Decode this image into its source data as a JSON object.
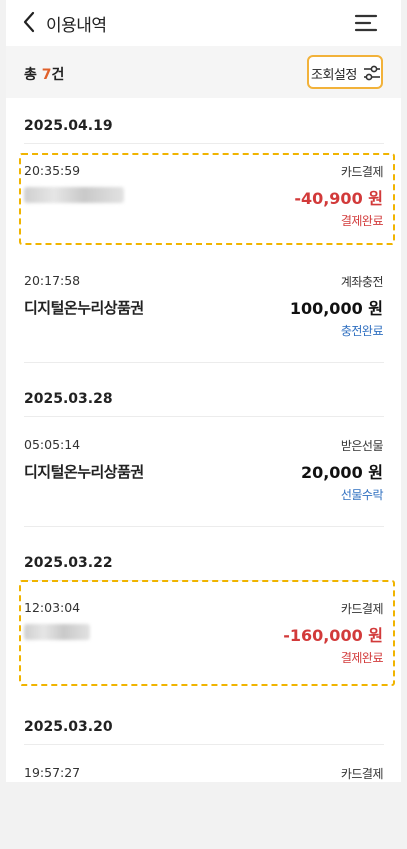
{
  "header": {
    "title": "이용내역",
    "back_icon": "chevron-left-icon",
    "menu_icon": "hamburger-menu-icon"
  },
  "summary": {
    "total_prefix": "총",
    "total_count": "7",
    "total_suffix": "건",
    "filter_label": "조회설정",
    "filter_icon": "sliders-icon"
  },
  "groups": [
    {
      "date": "2025.04.19",
      "items": [
        {
          "time": "20:35:59",
          "type": "카드결제",
          "name": "",
          "amount": "-40,900 원",
          "status": "결제완료"
        },
        {
          "time": "20:17:58",
          "type": "계좌충전",
          "name": "디지털온누리상품권",
          "amount": "100,000 원",
          "status": "충전완료"
        }
      ]
    },
    {
      "date": "2025.03.28",
      "items": [
        {
          "time": "05:05:14",
          "type": "받은선물",
          "name": "디지털온누리상품권",
          "amount": "20,000 원",
          "status": "선물수락"
        }
      ]
    },
    {
      "date": "2025.03.22",
      "items": [
        {
          "time": "12:03:04",
          "type": "카드결제",
          "name": "",
          "amount": "-160,000 원",
          "status": "결제완료"
        }
      ]
    },
    {
      "date": "2025.03.20",
      "items": [
        {
          "time": "19:57:27",
          "type": "카드결제",
          "name": "",
          "amount": "",
          "status": ""
        }
      ]
    }
  ],
  "colors": {
    "negative": "#d23a3a",
    "status_blue": "#2f6fc0",
    "highlight": "#f0b400",
    "count_accent": "#e0602a"
  }
}
